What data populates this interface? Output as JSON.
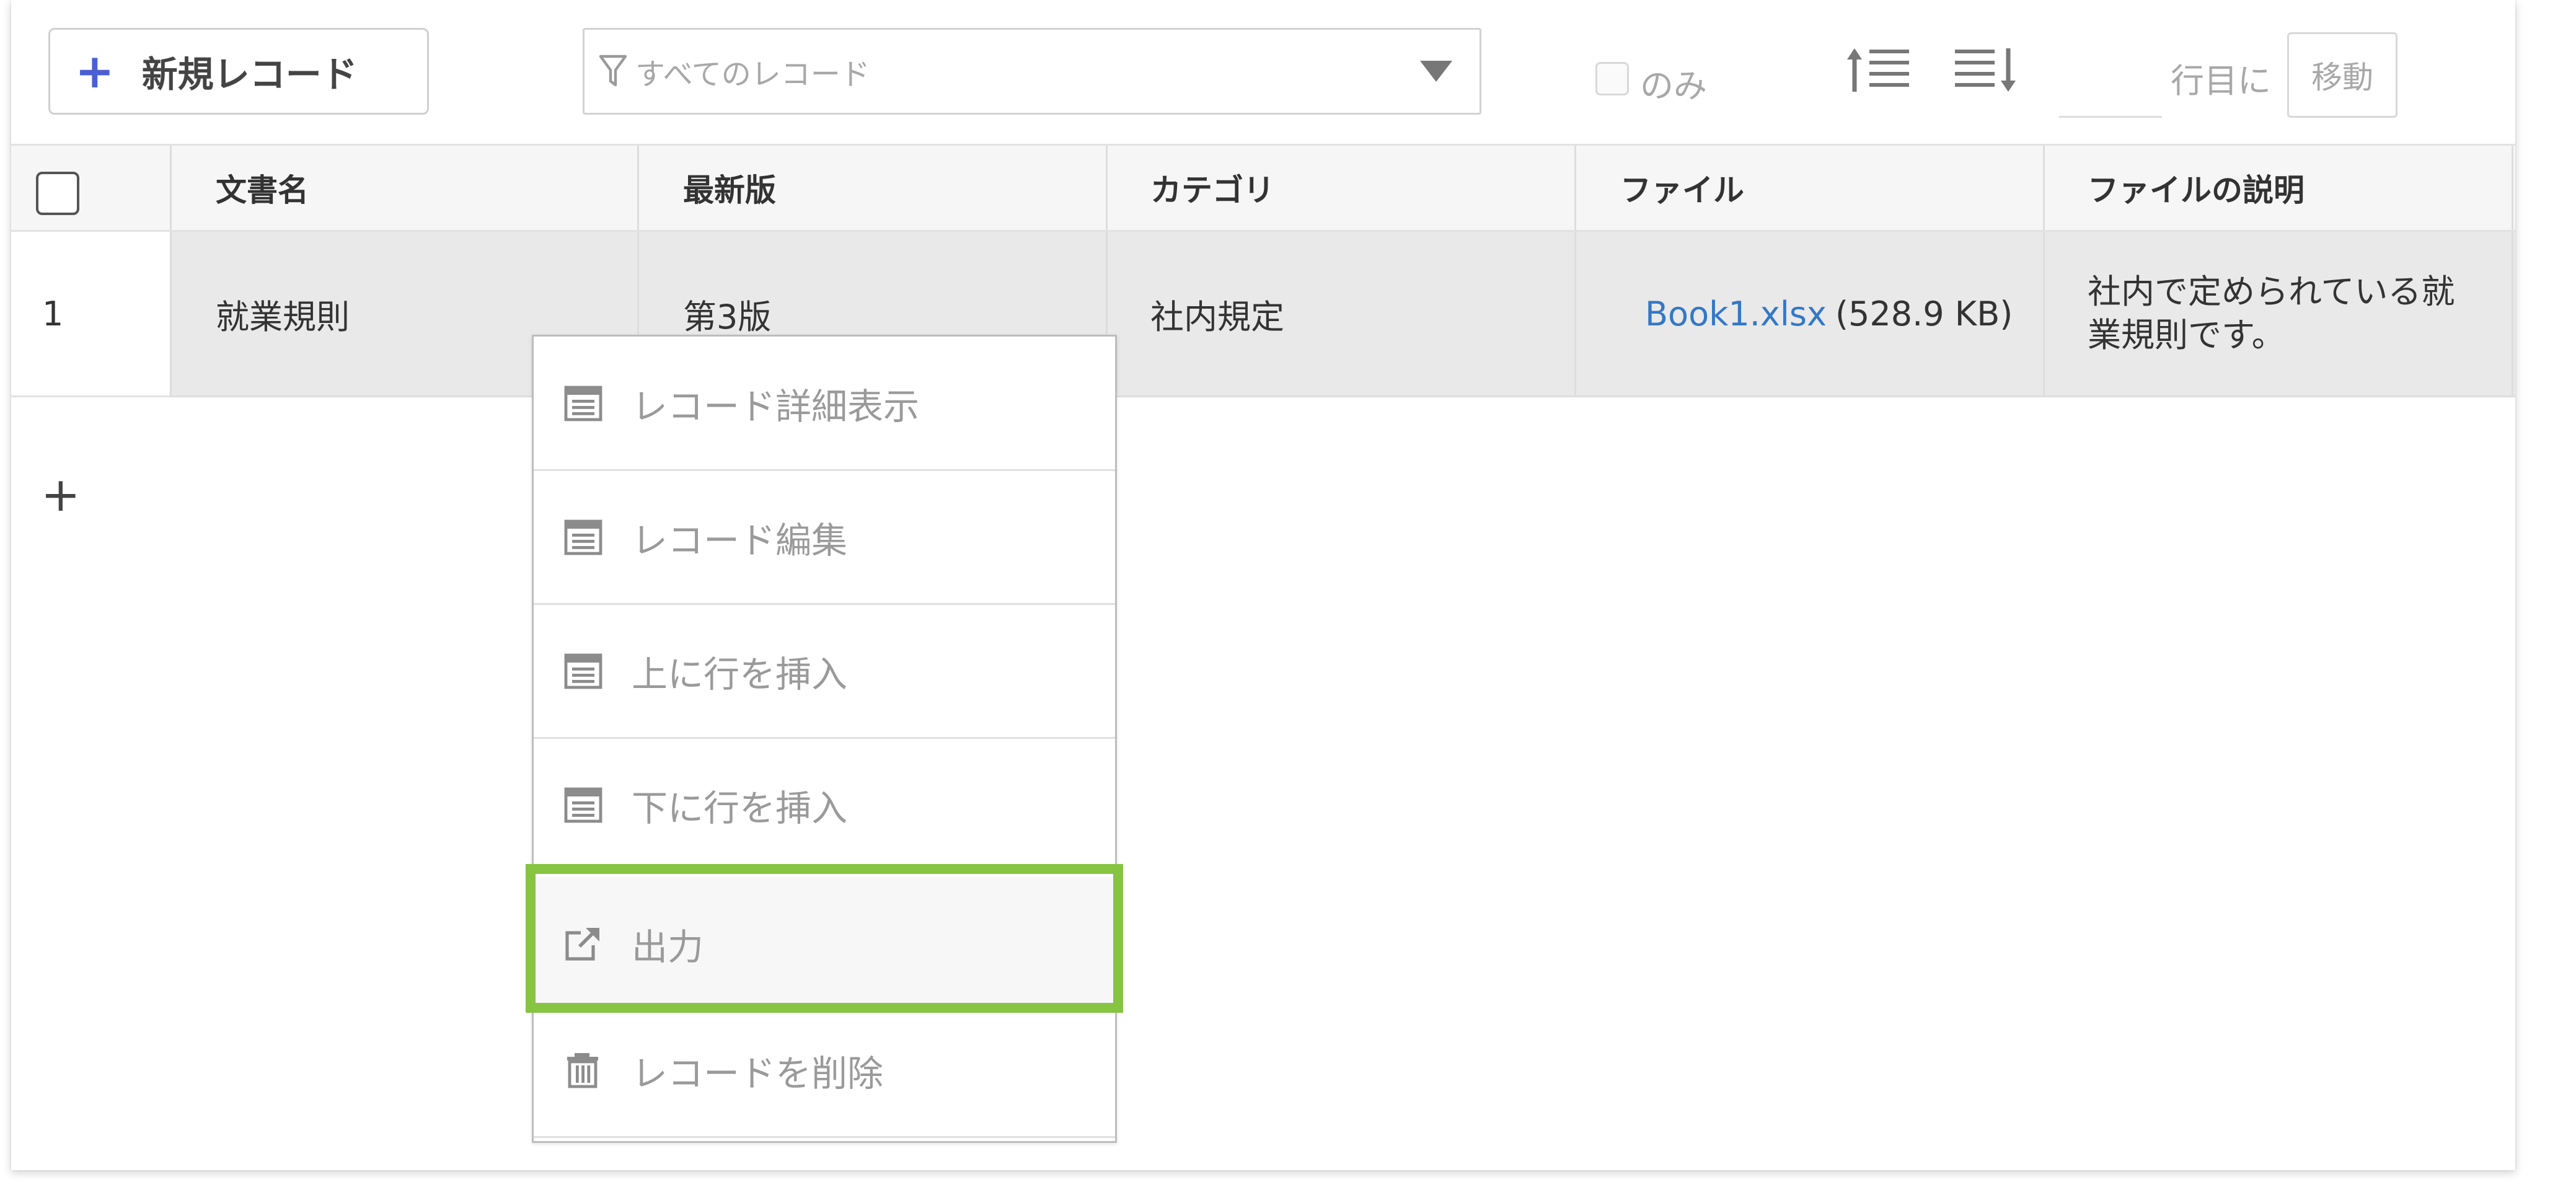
{
  "toolbar": {
    "new_record_label": "新規レコード",
    "filter_placeholder": "すべてのレコード",
    "only_label": "のみ",
    "goto_suffix": "行目に",
    "goto_button": "移動",
    "goto_value": ""
  },
  "grid": {
    "columns": [
      "文書名",
      "最新版",
      "カテゴリ",
      "ファイル",
      "ファイルの説明"
    ],
    "rows": [
      {
        "number": "1",
        "document_name": "就業規則",
        "latest_version": "第3版",
        "category": "社内規定",
        "file_name": "Book1.xlsx",
        "file_size": "(528.9 KB)",
        "file_description_line1": "社内で定められている就",
        "file_description_line2": "業規則です。"
      }
    ],
    "add_row": "+"
  },
  "context_menu": {
    "items": [
      {
        "label": "レコード詳細表示",
        "icon": "form-icon"
      },
      {
        "label": "レコード編集",
        "icon": "form-icon"
      },
      {
        "label": "上に行を挿入",
        "icon": "form-icon"
      },
      {
        "label": "下に行を挿入",
        "icon": "form-icon"
      },
      {
        "label": "出力",
        "icon": "external-link-icon",
        "highlighted": true
      },
      {
        "label": "レコードを削除",
        "icon": "trash-icon"
      }
    ]
  },
  "colors": {
    "accent_plus": "#4a5fd3",
    "link": "#3478c6",
    "highlight": "#86c441"
  }
}
